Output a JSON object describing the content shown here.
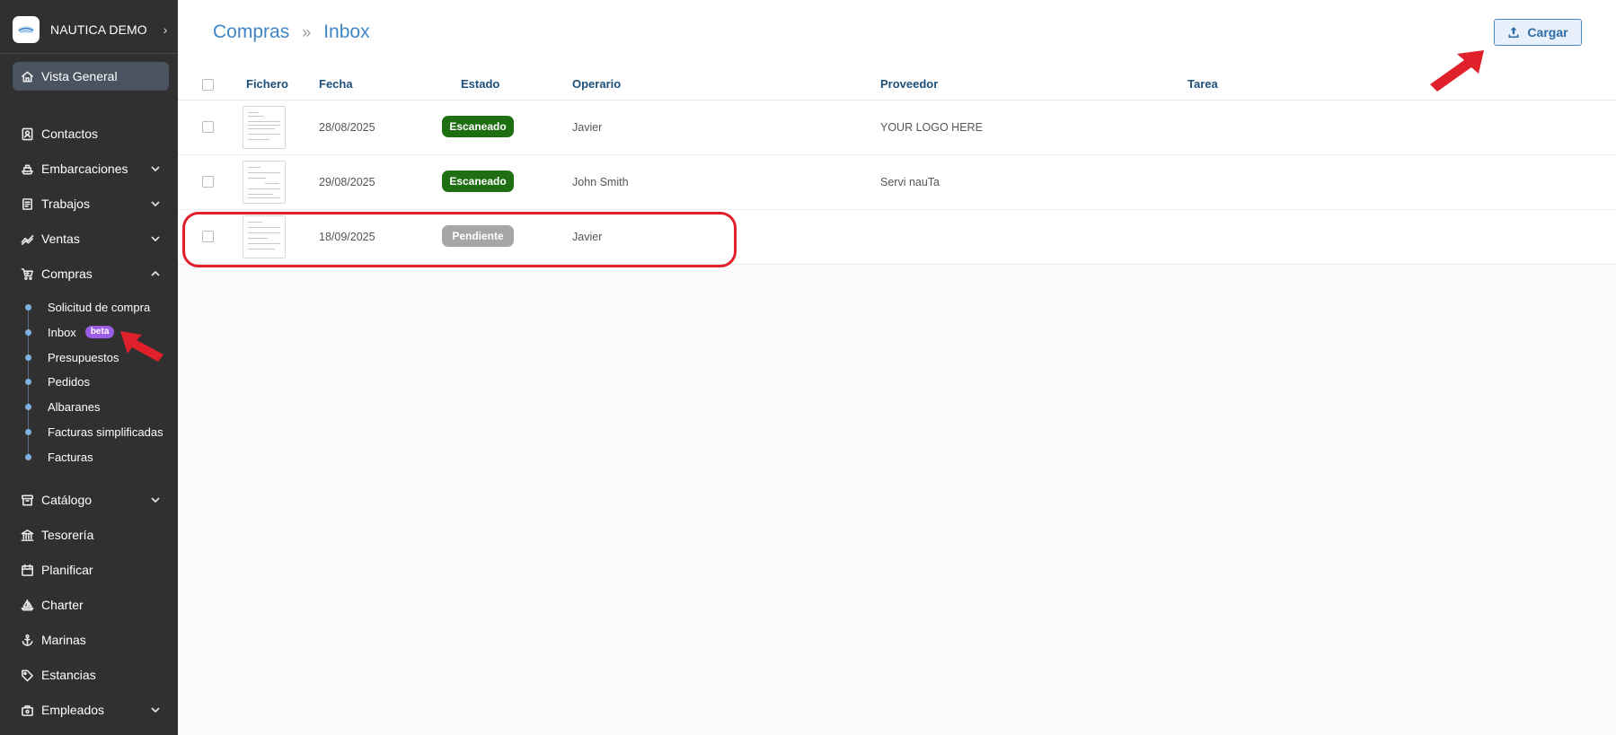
{
  "sidebar": {
    "brand": {
      "name": "NAUTICA DEMO",
      "chevron": "›"
    },
    "overview": {
      "label": "Vista General",
      "icon": "home-icon"
    },
    "items": [
      {
        "label": "Contactos",
        "icon": "contact-card-icon"
      },
      {
        "label": "Embarcaciones",
        "icon": "ship-icon"
      },
      {
        "label": "Trabajos",
        "icon": "clipboard-icon"
      },
      {
        "label": "Ventas",
        "icon": "trend-icon"
      },
      {
        "label": "Compras",
        "icon": "cart-icon"
      },
      {
        "label": "Catálogo",
        "icon": "archive-icon"
      },
      {
        "label": "Tesorería",
        "icon": "bank-icon"
      },
      {
        "label": "Planificar",
        "icon": "calendar-icon"
      },
      {
        "label": "Charter",
        "icon": "sailboat-icon"
      },
      {
        "label": "Marinas",
        "icon": "anchor-icon"
      },
      {
        "label": "Estancias",
        "icon": "tag-icon"
      },
      {
        "label": "Empleados",
        "icon": "briefcase-icon"
      }
    ],
    "compras_sub": [
      {
        "label": "Solicitud de compra"
      },
      {
        "label": "Inbox",
        "badge": "beta"
      },
      {
        "label": "Presupuestos"
      },
      {
        "label": "Pedidos"
      },
      {
        "label": "Albaranes"
      },
      {
        "label": "Facturas simplificadas"
      },
      {
        "label": "Facturas"
      }
    ]
  },
  "header": {
    "breadcrumb": [
      "Compras",
      "Inbox"
    ],
    "separator": "»",
    "load_button": "Cargar"
  },
  "table": {
    "columns": [
      "Fichero",
      "Fecha",
      "Estado",
      "Operario",
      "Proveedor",
      "Tarea"
    ],
    "rows": [
      {
        "fecha": "28/08/2025",
        "estado": "Escaneado",
        "operario": "Javier",
        "proveedor": "YOUR LOGO HERE",
        "tarea": ""
      },
      {
        "fecha": "29/08/2025",
        "estado": "Escaneado",
        "operario": "John Smith",
        "proveedor": "Servi nauTa",
        "tarea": ""
      },
      {
        "fecha": "18/09/2025",
        "estado": "Pendiente",
        "operario": "Javier",
        "proveedor": "",
        "tarea": ""
      }
    ]
  },
  "colors": {
    "sidebar_bg": "#303030",
    "accent": "#4285c4",
    "status_scanned": "#1e6e12",
    "status_pending": "#a6a6a6",
    "annotation": "#e0202a"
  }
}
